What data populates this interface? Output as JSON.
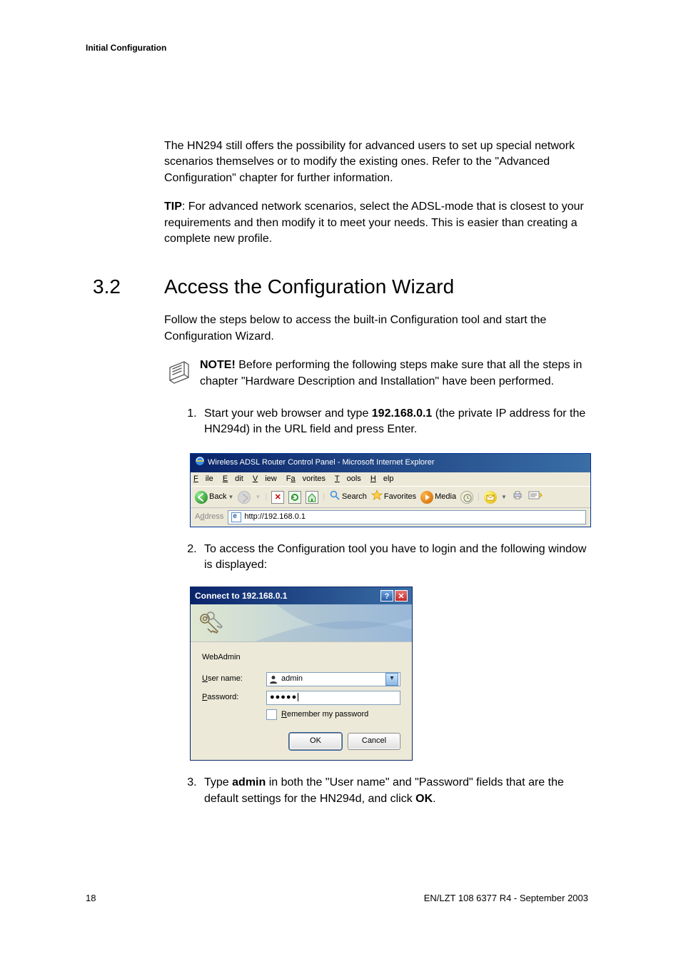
{
  "header": {
    "title": "Initial Configuration"
  },
  "intro": {
    "p1": "The HN294 still offers the possibility for advanced users to set up special network scenarios themselves or to modify the existing ones. Refer to the \"Advanced Configuration\" chapter for further information.",
    "tip_label": "TIP",
    "tip_text": ": For advanced network scenarios, select the ADSL-mode that is closest to your requirements and then modify it to meet your needs. This is easier than creating a complete new profile."
  },
  "section": {
    "number": "3.2",
    "title": "Access the Configuration Wizard",
    "intro": "Follow the steps below to access the built-in Configuration tool and start the Configuration Wizard.",
    "note_label": "NOTE!",
    "note_text": " Before performing the following steps make sure that all the steps in chapter \"Hardware Description and Installation\" have been performed.",
    "step1_a": "Start your web browser and type ",
    "step1_ip": "192.168.0.1",
    "step1_b": " (the private IP address for the HN294d) in the URL field and press Enter.",
    "step2": "To access the Configuration tool you have to login and the following window is displayed:",
    "step3_a": "Type ",
    "step3_admin": "admin",
    "step3_b": " in both the \"User name\" and \"Password\" fields that are the default settings for the HN294d, and click ",
    "step3_ok": "OK",
    "step3_c": "."
  },
  "ie": {
    "title": "Wireless ADSL Router Control Panel - Microsoft Internet Explorer",
    "menu": {
      "file": "File",
      "edit": "Edit",
      "view": "View",
      "favorites": "Favorites",
      "tools": "Tools",
      "help": "Help"
    },
    "toolbar": {
      "back": "Back",
      "search": "Search",
      "favorites": "Favorites",
      "media": "Media"
    },
    "address_label": "Address",
    "address_value": "http://192.168.0.1"
  },
  "login": {
    "title": "Connect to 192.168.0.1",
    "realm": "WebAdmin",
    "username_label_u": "U",
    "username_label_rest": "ser name:",
    "username_value": "admin",
    "password_label_u": "P",
    "password_label_rest": "assword:",
    "password_value": "●●●●●",
    "remember_u": "R",
    "remember_rest": "emember my password",
    "ok": "OK",
    "cancel": "Cancel"
  },
  "footer": {
    "page": "18",
    "docid": "EN/LZT 108 6377 R4 - September 2003"
  }
}
